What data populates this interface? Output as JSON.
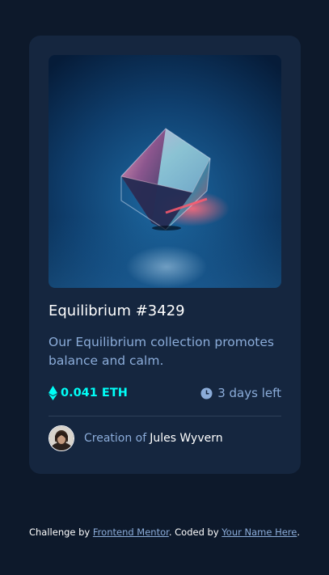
{
  "card": {
    "image_alt": "equilibrium-cube-image",
    "title": "Equilibrium #3429",
    "description": "Our Equilibrium collection promotes balance and calm.",
    "price": "0.041 ETH",
    "time_left": "3 days left",
    "creator_prefix": "Creation of",
    "creator_name": "Jules Wyvern"
  },
  "icons": {
    "price": "ethereum-icon",
    "time": "clock-icon",
    "avatar": "avatar-image"
  },
  "footer": {
    "challenge_prefix": "Challenge by",
    "challenge_link": "Frontend Mentor",
    "coded_prefix": ". Coded by",
    "coded_link": "Your Name Here",
    "end": "."
  },
  "colors": {
    "page_bg": "#0d192b",
    "card_bg": "#15263f",
    "cyan": "#00fff8",
    "soft_blue": "#8bacd9",
    "white": "#ffffff",
    "divider": "#2e405a"
  }
}
